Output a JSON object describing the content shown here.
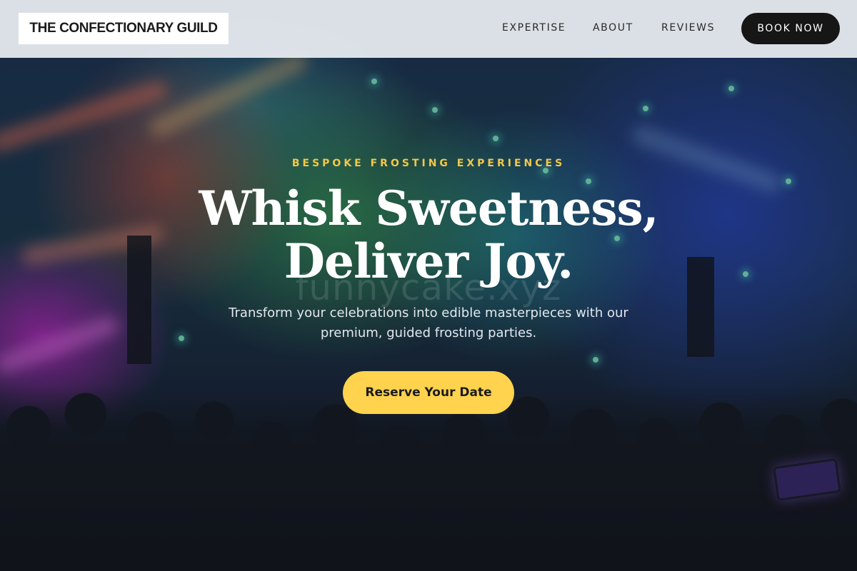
{
  "brand": {
    "name": "THE CONFECTIONARY GUILD"
  },
  "nav": {
    "links": [
      {
        "label": "EXPERTISE"
      },
      {
        "label": "ABOUT"
      },
      {
        "label": "REVIEWS"
      }
    ],
    "cta_label": "BOOK NOW"
  },
  "hero": {
    "eyebrow": "BESPOKE FROSTING EXPERIENCES",
    "headline_line1": "Whisk Sweetness,",
    "headline_line2": "Deliver Joy.",
    "subline_line1": "Transform your celebrations into edible masterpieces with our",
    "subline_line2": "premium, guided frosting parties.",
    "cta_label": "Reserve Your Date",
    "watermark": "funnycake.xyz",
    "background_image": "concert-crowd-image"
  },
  "colors": {
    "accent": "#ffd34d",
    "eyebrow": "#f2c84b",
    "nav_button": "#161616",
    "nav_bg": "#e8ecf0"
  }
}
